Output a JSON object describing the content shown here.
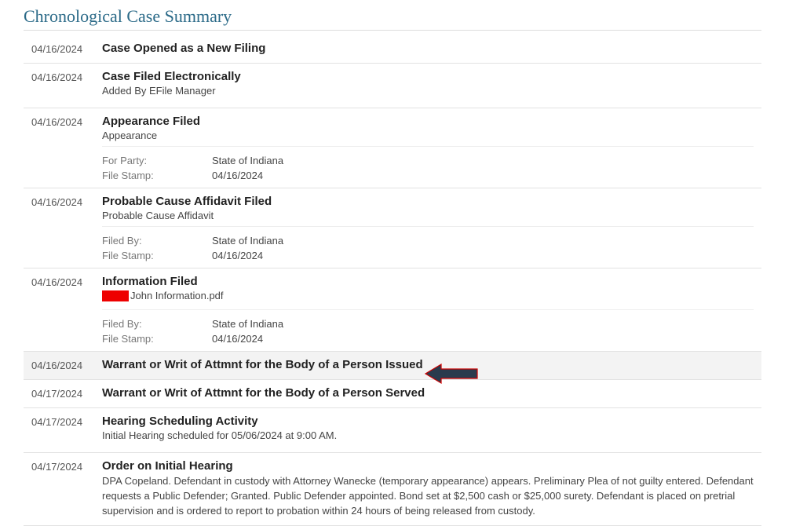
{
  "section_title": "Chronological Case Summary",
  "entries": [
    {
      "date": "04/16/2024",
      "title": "Case Opened as a New Filing"
    },
    {
      "date": "04/16/2024",
      "title": "Case Filed Electronically",
      "subtitle": "Added By EFile Manager"
    },
    {
      "date": "04/16/2024",
      "title": "Appearance Filed",
      "subtitle": "Appearance",
      "meta": [
        {
          "label": "For Party:",
          "value": "State of Indiana"
        },
        {
          "label": "File Stamp:",
          "value": "04/16/2024"
        }
      ]
    },
    {
      "date": "04/16/2024",
      "title": "Probable Cause Affidavit Filed",
      "subtitle": "Probable Cause Affidavit",
      "meta": [
        {
          "label": "Filed By:",
          "value": "State of Indiana"
        },
        {
          "label": "File Stamp:",
          "value": "04/16/2024"
        }
      ]
    },
    {
      "date": "04/16/2024",
      "title": "Information Filed",
      "file_suffix": " John Information.pdf",
      "meta": [
        {
          "label": "Filed By:",
          "value": "State of Indiana"
        },
        {
          "label": "File Stamp:",
          "value": "04/16/2024"
        }
      ]
    },
    {
      "date": "04/16/2024",
      "title": "Warrant or Writ of Attmnt for the Body of a Person Issued",
      "highlight": true,
      "arrow": true
    },
    {
      "date": "04/17/2024",
      "title": "Warrant or Writ of Attmnt for the Body of a Person Served"
    },
    {
      "date": "04/17/2024",
      "title": "Hearing Scheduling Activity",
      "subtitle": "Initial Hearing scheduled for 05/06/2024 at 9:00 AM."
    },
    {
      "date": "04/17/2024",
      "title": "Order on Initial Hearing",
      "description": "DPA Copeland. Defendant in custody with Attorney Wanecke (temporary appearance) appears. Preliminary Plea of not guilty entered. Defendant requests a Public Defender; Granted. Public Defender appointed. Bond set at $2,500 cash or $25,000 surety. Defendant is placed on pretrial supervision and is ordered to report to probation within 24 hours of being released from custody."
    }
  ]
}
